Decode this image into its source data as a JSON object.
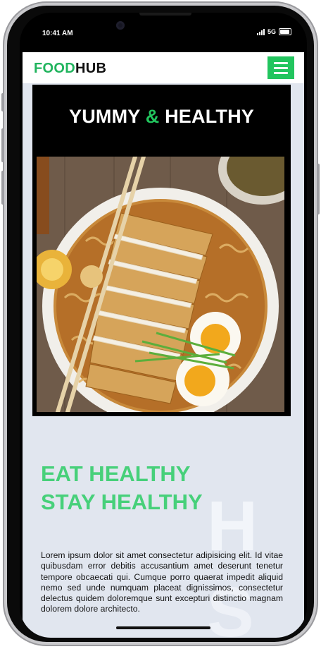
{
  "status_bar": {
    "time": "10:41 AM",
    "network": "5G"
  },
  "nav": {
    "logo_part1": "FOOD",
    "logo_part2": "HUB"
  },
  "hero": {
    "title_part1": "YUMMY",
    "title_amp": "&",
    "title_part2": "HEALTHY"
  },
  "section": {
    "headline_line1": "EAT HEALTHY",
    "headline_line2": "STAY HEALTHY",
    "bg_letter": "H",
    "body": "Lorem ipsum dolor sit amet consectetur adipisicing elit. Id vitae quibusdam error debitis accusantium amet deserunt tenetur tempore obcaecati qui. Cumque porro quaerat impedit aliquid nemo sed unde numquam placeat dignissimos, consectetur delectus quidem doloremque sunt excepturi distinctio magnam dolorem dolore architecto."
  },
  "colors": {
    "brand_green": "#22c55e",
    "headline_green": "#47d07a",
    "page_bg": "#e1e6ef"
  },
  "icons": {
    "menu": "hamburger-icon",
    "signal": "signal-icon",
    "battery": "battery-icon"
  }
}
